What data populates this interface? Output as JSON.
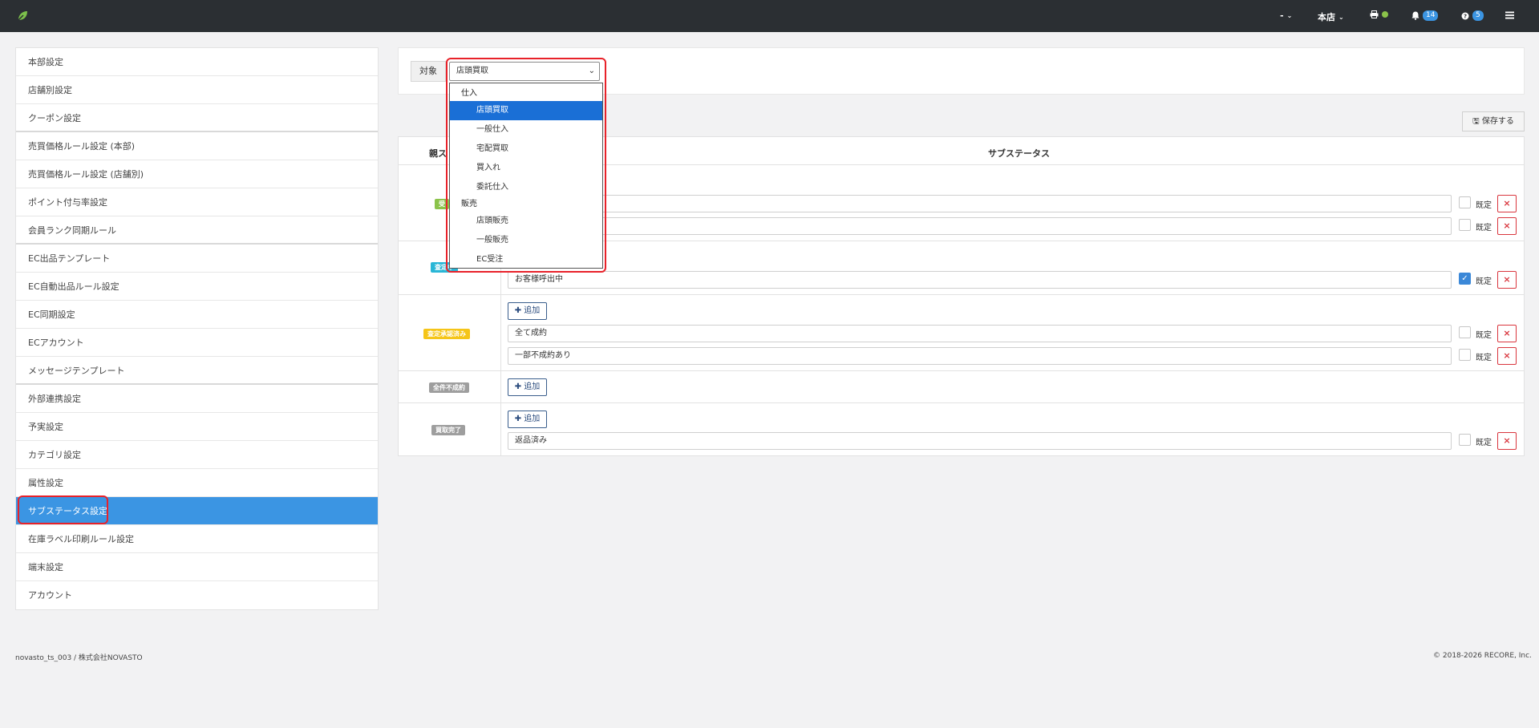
{
  "topbar": {
    "user_menu": "-",
    "store_menu": "本店",
    "notifications_count": "14",
    "help_count": "5",
    "colors": {
      "bar": "#2b2f33",
      "badge": "#3b95e3",
      "status_dot": "#8bc34a"
    }
  },
  "sidebar": {
    "items": [
      "本部設定",
      "店舗別設定",
      "クーポン設定",
      "売買価格ルール設定 (本部)",
      "売買価格ルール設定 (店舗別)",
      "ポイント付与率設定",
      "会員ランク同期ルール",
      "EC出品テンプレート",
      "EC自動出品ルール設定",
      "EC同期設定",
      "ECアカウント",
      "メッセージテンプレート",
      "外部連携設定",
      "予実設定",
      "カテゴリ設定",
      "属性設定",
      "サブステータス設定",
      "在庫ラベル印刷ルール設定",
      "端末設定",
      "アカウント"
    ],
    "active_index": 16
  },
  "filter": {
    "label": "対象",
    "selected": "店頭買取"
  },
  "dropdown": {
    "groups": [
      {
        "label": "仕入",
        "options": [
          "店頭買取",
          "一般仕入",
          "宅配買取",
          "買入れ",
          "委託仕入"
        ]
      },
      {
        "label": "販売",
        "options": [
          "店頭販売",
          "一般販売",
          "EC受注"
        ]
      }
    ],
    "highlighted": "店頭買取"
  },
  "toolbar": {
    "save_label": "保存する"
  },
  "table": {
    "headers": {
      "parent": "親ス",
      "sub": "サブステータス"
    },
    "add_label": "追加",
    "default_label": "既定",
    "rows": [
      {
        "status": "受",
        "color": "#8bc34a",
        "subs": [
          {
            "value": "",
            "default": false
          },
          {
            "value": "",
            "default": false
          }
        ]
      },
      {
        "status": "査定中",
        "color": "#29b6d6",
        "subs": [
          {
            "value": "お客様呼出中",
            "default": true
          }
        ]
      },
      {
        "status": "査定承認済み",
        "color": "#f5c518",
        "subs": [
          {
            "value": "全て成約",
            "default": false
          },
          {
            "value": "一部不成約あり",
            "default": false
          }
        ]
      },
      {
        "status": "全件不成約",
        "color": "#9e9e9e",
        "subs": []
      },
      {
        "status": "買取完了",
        "color": "#9e9e9e",
        "subs": [
          {
            "value": "返品済み",
            "default": false
          }
        ]
      }
    ]
  },
  "footer": {
    "left": "novasto_ts_003 / 株式会社NOVASTO",
    "right": "© 2018-2026 RECORE, Inc."
  }
}
